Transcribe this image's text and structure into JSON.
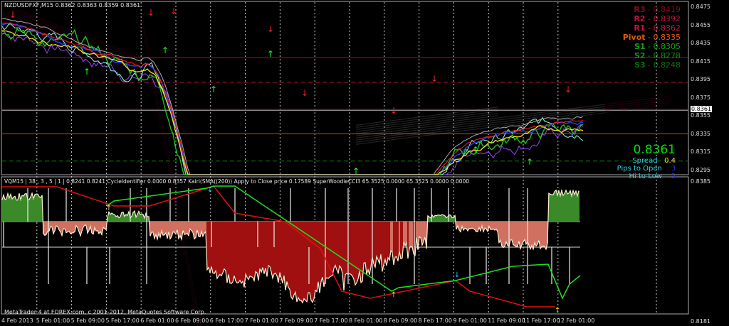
{
  "header": {
    "title": "NZDUSDFXF,M15  0.8362 0.8363 0.8359 0.8361"
  },
  "indicator": {
    "title": "VQM15 | 38 , 3 , 5 | 1  |  0.8241 0.8241  CycleIdentifier 0.0000 0.8357  Kairi(SMA((200)) Apply to Close price 0.17589  SuperWoodieCCI3 65.3525 0.0000 65.3525 0.0000 0.0000"
  },
  "footer": {
    "text": "MetaTrader 4 at FOREX.com, c 2001-2012, MetaQuotes Software Corp."
  },
  "pivots": [
    {
      "name": "R3",
      "value": "0.8419",
      "price": 0.8419,
      "color": "#8b0a1a",
      "lc": "#b0102a"
    },
    {
      "name": "R2",
      "value": "0.8392",
      "price": 0.8392,
      "color": "#c0143c",
      "lc": "#c0143c"
    },
    {
      "name": "R1",
      "value": "0.8362",
      "price": 0.8362,
      "color": "#d01040",
      "lc": "#c01030"
    },
    {
      "name": "Pivot",
      "value": "0.8335",
      "price": 0.8335,
      "color": "#e05a10",
      "lc": "#e04020"
    },
    {
      "name": "S1",
      "value": "0.8305",
      "price": 0.8305,
      "color": "#10a010",
      "lc": "#108010"
    },
    {
      "name": "S2",
      "value": "0.8278",
      "price": 0.8278,
      "color": "#109010",
      "lc": "#108010"
    },
    {
      "name": "S3",
      "value": "0.8248",
      "price": 0.8248,
      "color": "#0c700c",
      "lc": "#0c700c"
    }
  ],
  "info": {
    "price": "0.8361",
    "spread_label": "Spread",
    "spread": "0.4",
    "pips_label": "Pips to Open",
    "pips": "3",
    "hilo_label": "Hi to Low",
    "hilo": "5"
  },
  "price_axis": [
    "0.8475",
    "0.8455",
    "0.8435",
    "0.8415",
    "0.8395",
    "0.8375",
    "0.8355",
    "0.8335",
    "0.8315",
    "0.8295"
  ],
  "current_price": "0.8361",
  "sub_axis": {
    "top": "0.8385",
    "bottom": "0.8181"
  },
  "time_axis": [
    "4 Feb 2013",
    "5 Feb 01:00",
    "5 Feb 09:00",
    "5 Feb 17:00",
    "6 Feb 01:00",
    "6 Feb 09:00",
    "6 Feb 17:00",
    "7 Feb 01:00",
    "7 Feb 09:00",
    "7 Feb 17:00",
    "8 Feb 01:00",
    "8 Feb 09:00",
    "8 Feb 17:00",
    "9 Feb 01:00",
    "11 Feb 09:00",
    "11 Feb 17:00",
    "12 Feb 01:00"
  ]
}
